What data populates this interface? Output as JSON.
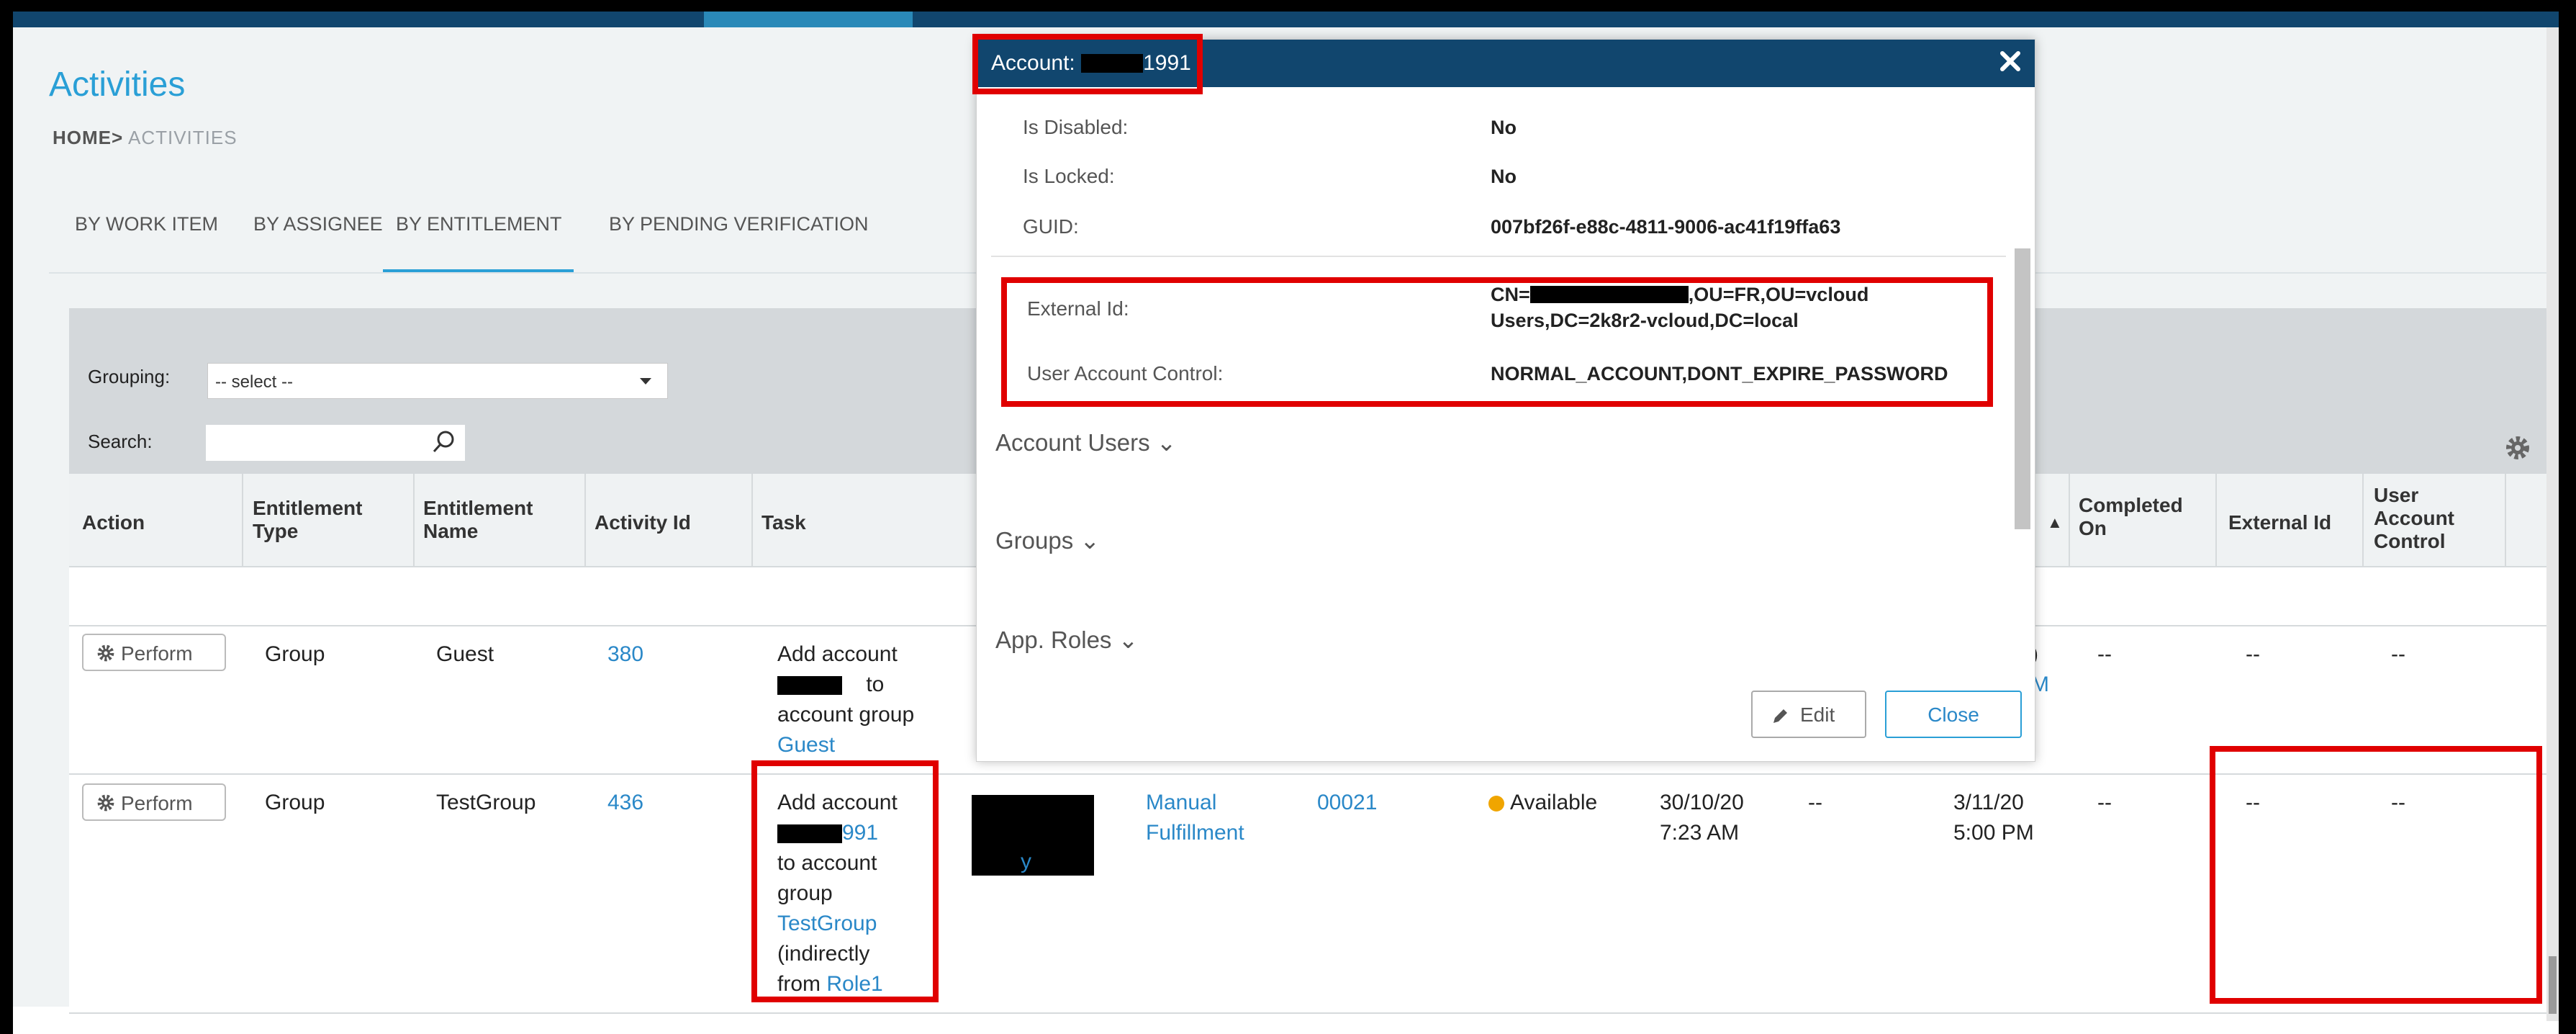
{
  "page": {
    "title": "Activities",
    "breadcrumb_home": "HOME",
    "breadcrumb_sep": ">",
    "breadcrumb_current": "ACTIVITIES"
  },
  "tabs": [
    "BY WORK ITEM",
    "BY ASSIGNEE",
    "BY ENTITLEMENT",
    "BY PENDING VERIFICATION"
  ],
  "filters": {
    "grouping_label": "Grouping:",
    "grouping_value": "-- select --",
    "search_label": "Search:",
    "search_value": ""
  },
  "table": {
    "columns": [
      "Action",
      "Entitlement Type",
      "Entitlement Name",
      "Activity Id",
      "Task",
      "Completed On",
      "External Id",
      "User Account Control"
    ],
    "rows": [
      {
        "action": "Perform",
        "ent_type": "Group",
        "ent_name": "Guest",
        "activity_id": "380",
        "task_line1": "Add account",
        "task_line2": "to",
        "task_line3": "account group",
        "task_link": "Guest",
        "frag_a": ")",
        "frag_b": "M",
        "completed_on": "--",
        "external_id": "--",
        "uac": "--"
      },
      {
        "action": "Perform",
        "ent_type": "Group",
        "ent_name": "TestGroup",
        "activity_id": "436",
        "task_line1": "Add account",
        "task_id_suffix": "991",
        "task_line3": "to account",
        "task_line4": "group",
        "task_link": "TestGroup",
        "task_line6": "(indirectly",
        "task_line7_pre": "from",
        "task_role": "Role1",
        "assignee_frag": "y",
        "fulfillment_1": "Manual",
        "fulfillment_2": "Fulfillment",
        "number": "00021",
        "status": "Available",
        "created_1": "30/10/20",
        "created_2": "7:23 AM",
        "dash": "--",
        "due_1": "3/11/20",
        "due_2": "5:00 PM",
        "completed_on": "--",
        "external_id": "--",
        "uac": "--"
      }
    ]
  },
  "modal": {
    "title_prefix": "Account:",
    "title_suffix": "1991",
    "fields": [
      {
        "label": "Is Disabled:",
        "value": "No"
      },
      {
        "label": "Is Locked:",
        "value": "No"
      },
      {
        "label": "GUID:",
        "value": "007bf26f-e88c-4811-9006-ac41f19ffa63"
      },
      {
        "label": "External Id:",
        "value_line1_prefix": "CN=",
        "value_line1_suffix": ",OU=FR,OU=vcloud",
        "value_line2": "Users,DC=2k8r2-vcloud,DC=local"
      },
      {
        "label": "User Account Control:",
        "value": "NORMAL_ACCOUNT,DONT_EXPIRE_PASSWORD"
      }
    ],
    "sections": [
      "Account Users",
      "Groups",
      "App. Roles"
    ],
    "edit_label": "Edit",
    "close_label": "Close"
  },
  "colors": {
    "header_navy": "#11466e",
    "accent_blue": "#2a9fd6",
    "link_blue": "#2a88c8",
    "highlight_red": "#e00000",
    "status_available": "#f0a500"
  }
}
